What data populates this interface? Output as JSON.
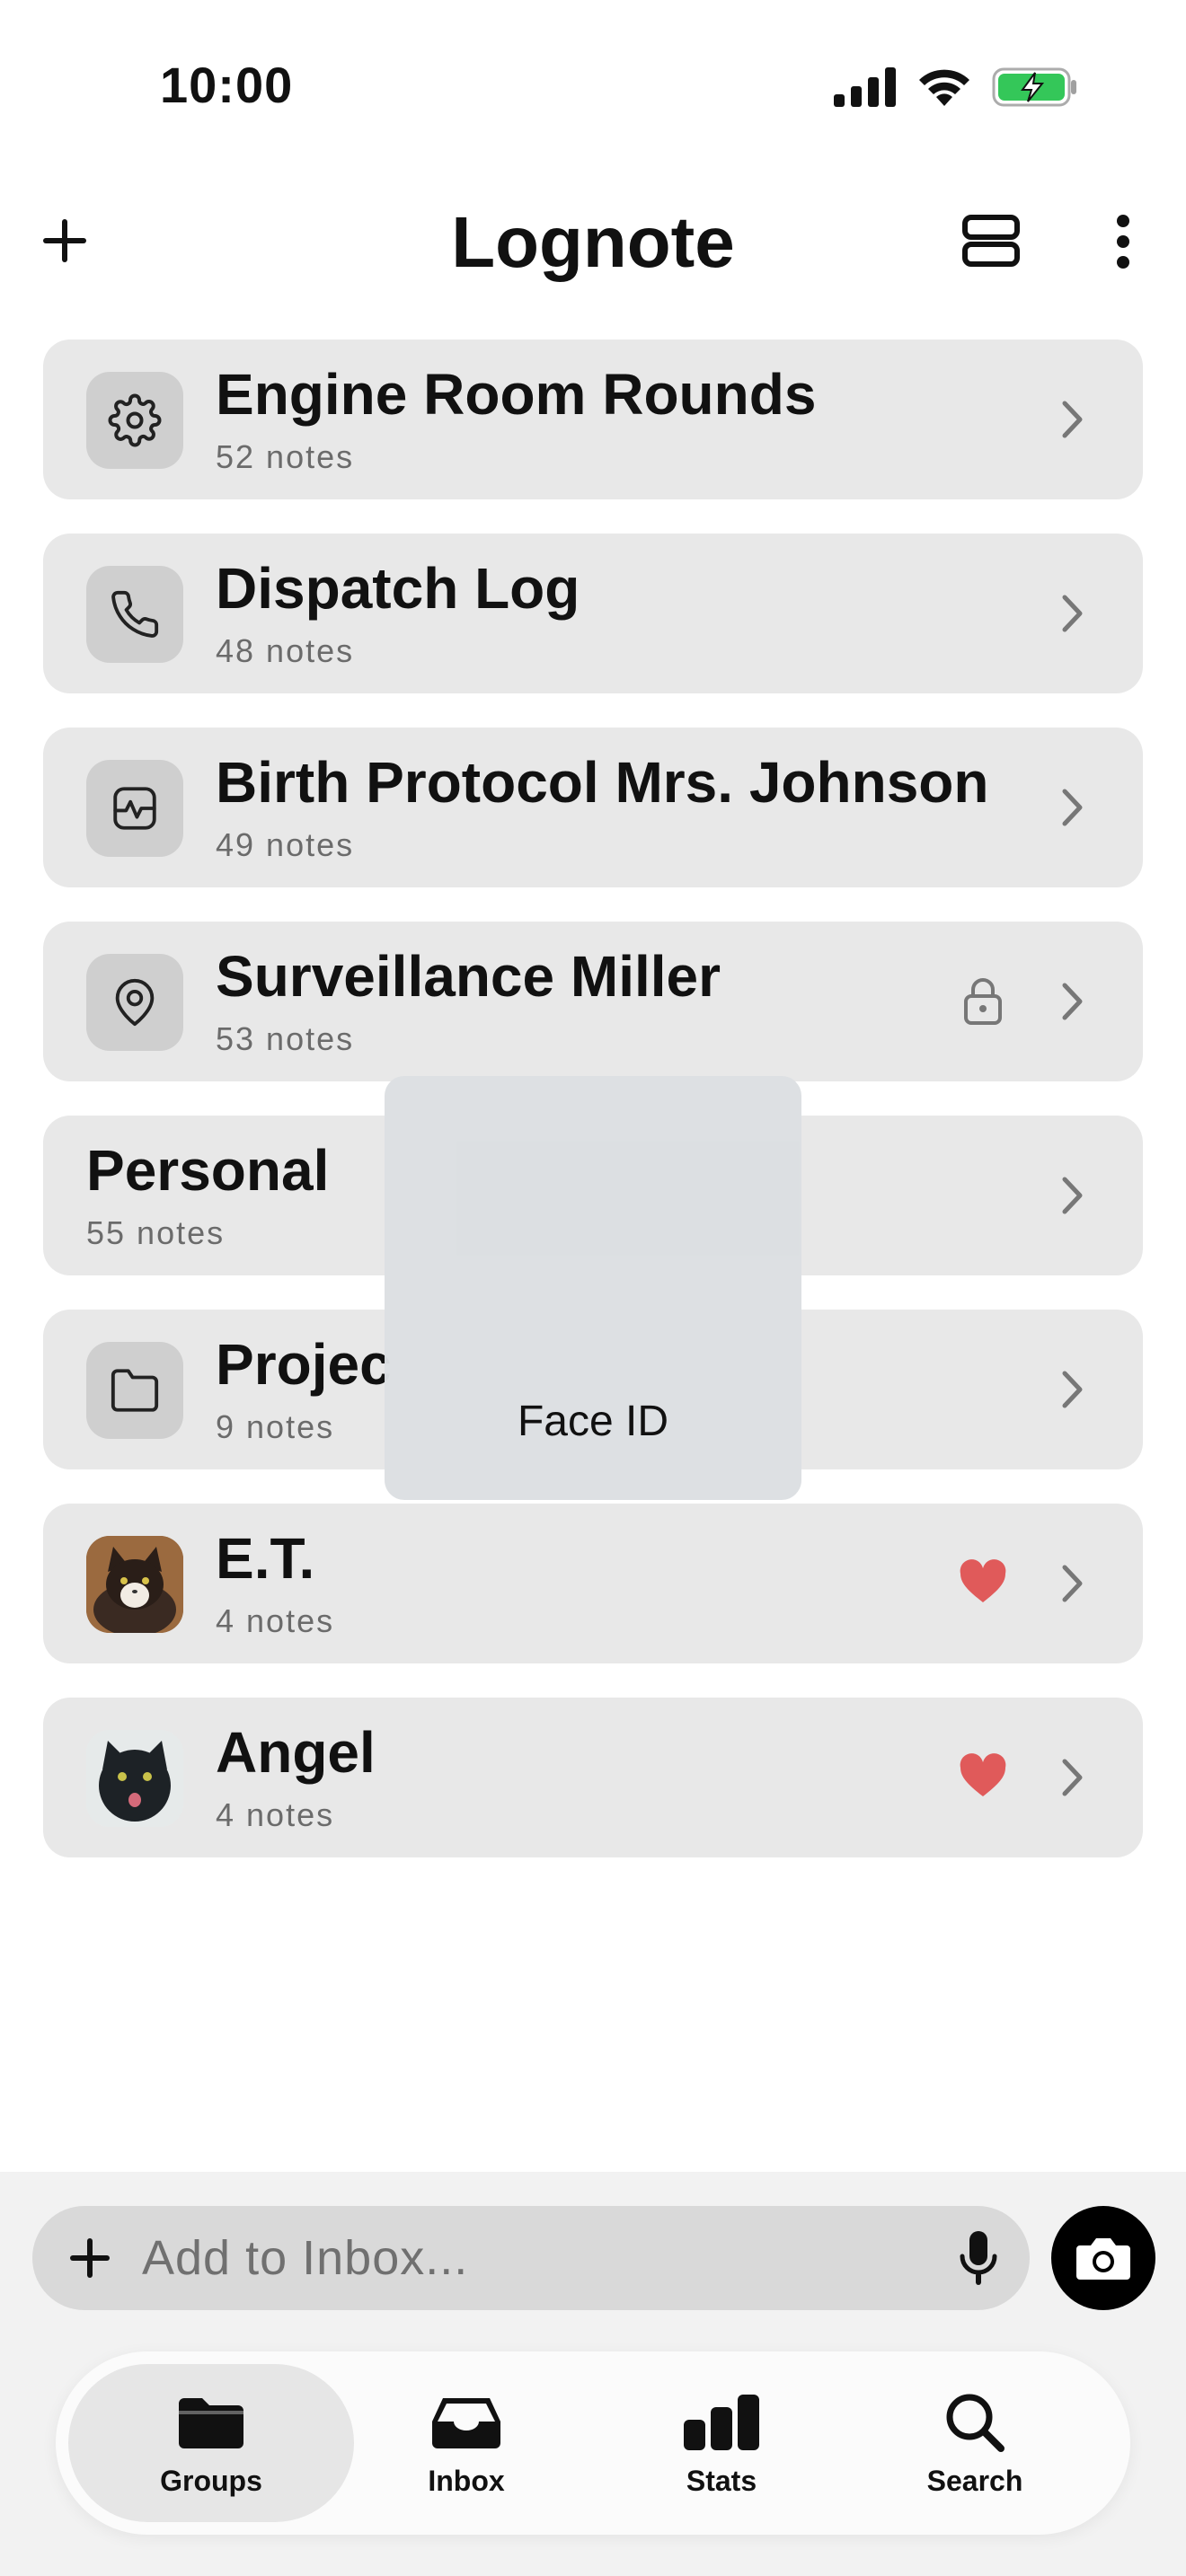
{
  "status_bar": {
    "time": "10:00"
  },
  "header": {
    "title": "Lognote"
  },
  "groups": [
    {
      "name": "Engine Room Rounds",
      "count": "52 notes",
      "icon": "gear-icon"
    },
    {
      "name": "Dispatch Log",
      "count": "48 notes",
      "icon": "phone-icon"
    },
    {
      "name": "Birth Protocol Mrs. Johnson",
      "count": "49 notes",
      "icon": "waveform-icon"
    },
    {
      "name": "Surveillance Miller",
      "count": "53 notes",
      "icon": "location-pin-icon",
      "badge": "lock-icon"
    },
    {
      "name": "Personal",
      "count": "55 notes",
      "icon": ""
    },
    {
      "name": "Projec",
      "count": "9 notes",
      "icon": "folder-icon"
    },
    {
      "name": "E.T.",
      "count": "4 notes",
      "icon": "cat-photo",
      "badge": "heart-icon"
    },
    {
      "name": "Angel",
      "count": "4 notes",
      "icon": "cat-photo",
      "badge": "heart-icon"
    }
  ],
  "face_id": {
    "label": "Face ID"
  },
  "inbox": {
    "placeholder": "Add to Inbox..."
  },
  "tabs": [
    {
      "label": "Groups",
      "icon": "folder-icon",
      "active": true
    },
    {
      "label": "Inbox",
      "icon": "tray-icon",
      "active": false
    },
    {
      "label": "Stats",
      "icon": "bar-chart-icon",
      "active": false
    },
    {
      "label": "Search",
      "icon": "search-icon",
      "active": false
    }
  ],
  "colors": {
    "accent_heart": "#e05a5a",
    "battery_green": "#34c759",
    "row_bg": "#e8e8e8"
  }
}
